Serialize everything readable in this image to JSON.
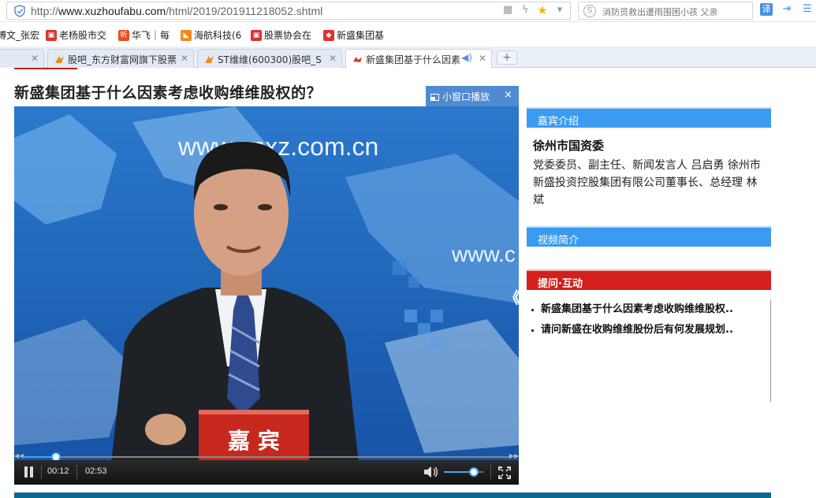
{
  "browser": {
    "url_prefix": "http://",
    "url_host": "www.xuzhoufabu.com",
    "url_path": "/html/2019/201911218052.shtml",
    "search_placeholder": "消防员救出遭雨围困小孩 父亲",
    "translate_label": "译"
  },
  "bookmarks": [
    {
      "label": "博文_张宏",
      "icon_color": "#ffffff"
    },
    {
      "label": "老杨股市交",
      "icon_color": "#e0322c"
    },
    {
      "label": "华飞｜每",
      "icon_color": "#e8501e"
    },
    {
      "label": "海航科技(6",
      "icon_color": "#f08a18"
    },
    {
      "label": "股票协会在",
      "icon_color": "#e0322c"
    },
    {
      "label": "新盛集团基",
      "icon_color": "#e0322c"
    }
  ],
  "tabs": [
    {
      "label": "",
      "active": false
    },
    {
      "label": "股吧_东方财富网旗下股票",
      "active": false
    },
    {
      "label": "ST维维(600300)股吧_S",
      "active": false
    },
    {
      "label": "新盛集团基于什么因素",
      "active": true
    }
  ],
  "page": {
    "title": "新盛集团基于什么因素考虑收购维维股权的？"
  },
  "player": {
    "mini_window_label": "小窗口播放",
    "mini_close": "×",
    "current_time": "00:12",
    "duration": "02:53",
    "progress_fraction": 0.069,
    "volume_fraction": 0.75,
    "backdrop_text": "www.cnxz.com.cn",
    "backdrop_text2": "www.c",
    "nameplate_text": "嘉 宾",
    "collapse_glyph": "《"
  },
  "sidebar": {
    "guest_header": "嘉宾介绍",
    "guest_name": "徐州市国资委",
    "guest_desc": "党委委员、副主任、新闻发言人 吕启勇 徐州市新盛投资控股集团有限公司董事长、总经理 林斌",
    "video_header": "视频简介",
    "qa_header": "提问·互动",
    "qa_items": [
      "新盛集团基于什么因素考虑收购维维股权..",
      "请问新盛在收购维维股份后有何发展规划.."
    ]
  },
  "colors": {
    "accent_blue": "#3a9bf0",
    "accent_red": "#d3201c",
    "player_blue": "#1b63b5"
  }
}
